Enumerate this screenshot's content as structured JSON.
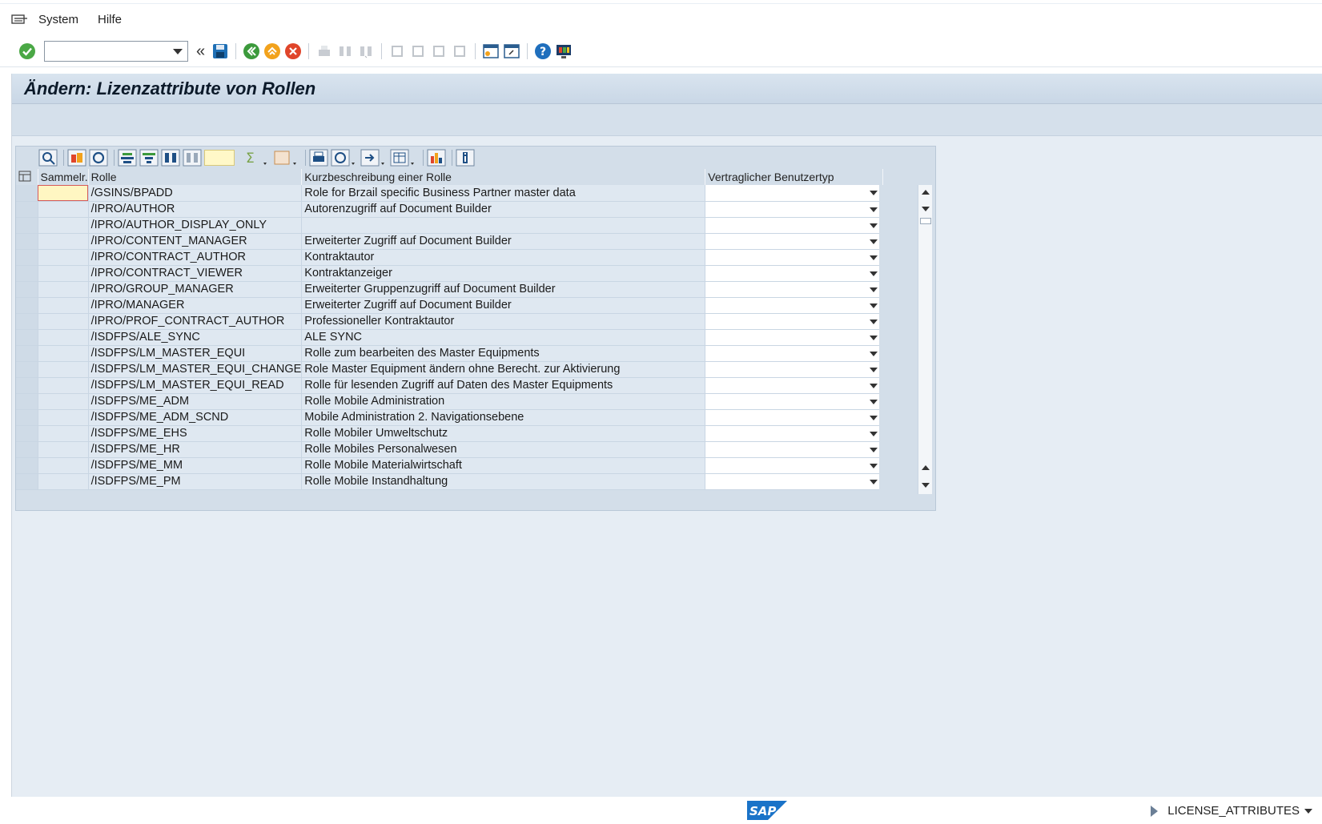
{
  "menu": {
    "items": [
      "System",
      "Hilfe"
    ]
  },
  "toolbar": {
    "command_value": "",
    "back_glyph": "«"
  },
  "screen": {
    "title": "Ändern: Lizenzattribute von Rollen"
  },
  "grid": {
    "columns": [
      "Sammelr.",
      "Rolle",
      "Kurzbeschreibung einer Rolle",
      "Vertraglicher Benutzertyp"
    ],
    "rows": [
      {
        "sammelr": "",
        "rolle": "/GSINS/BPADD",
        "beschreibung": "Role for Brzail specific Business Partner master data",
        "typ": ""
      },
      {
        "sammelr": "",
        "rolle": "/IPRO/AUTHOR",
        "beschreibung": "Autorenzugriff auf Document Builder",
        "typ": ""
      },
      {
        "sammelr": "",
        "rolle": "/IPRO/AUTHOR_DISPLAY_ONLY",
        "beschreibung": "",
        "typ": ""
      },
      {
        "sammelr": "",
        "rolle": "/IPRO/CONTENT_MANAGER",
        "beschreibung": "Erweiterter Zugriff auf Document Builder",
        "typ": ""
      },
      {
        "sammelr": "",
        "rolle": "/IPRO/CONTRACT_AUTHOR",
        "beschreibung": "Kontraktautor",
        "typ": ""
      },
      {
        "sammelr": "",
        "rolle": "/IPRO/CONTRACT_VIEWER",
        "beschreibung": "Kontraktanzeiger",
        "typ": ""
      },
      {
        "sammelr": "",
        "rolle": "/IPRO/GROUP_MANAGER",
        "beschreibung": "Erweiterter Gruppenzugriff auf Document Builder",
        "typ": ""
      },
      {
        "sammelr": "",
        "rolle": "/IPRO/MANAGER",
        "beschreibung": "Erweiterter Zugriff auf Document Builder",
        "typ": ""
      },
      {
        "sammelr": "",
        "rolle": "/IPRO/PROF_CONTRACT_AUTHOR",
        "beschreibung": "Professioneller Kontraktautor",
        "typ": ""
      },
      {
        "sammelr": "",
        "rolle": "/ISDFPS/ALE_SYNC",
        "beschreibung": "ALE SYNC",
        "typ": ""
      },
      {
        "sammelr": "",
        "rolle": "/ISDFPS/LM_MASTER_EQUI",
        "beschreibung": "Rolle zum bearbeiten des Master Equipments",
        "typ": ""
      },
      {
        "sammelr": "",
        "rolle": "/ISDFPS/LM_MASTER_EQUI_CHANGE",
        "beschreibung": "Role Master Equipment ändern ohne Berecht. zur Aktivierung",
        "typ": ""
      },
      {
        "sammelr": "",
        "rolle": "/ISDFPS/LM_MASTER_EQUI_READ",
        "beschreibung": "Rolle für lesenden Zugriff auf Daten des Master Equipments",
        "typ": ""
      },
      {
        "sammelr": "",
        "rolle": "/ISDFPS/ME_ADM",
        "beschreibung": "Rolle Mobile Administration",
        "typ": ""
      },
      {
        "sammelr": "",
        "rolle": "/ISDFPS/ME_ADM_SCND",
        "beschreibung": "Mobile Administration 2. Navigationsebene",
        "typ": ""
      },
      {
        "sammelr": "",
        "rolle": "/ISDFPS/ME_EHS",
        "beschreibung": "Rolle Mobiler Umweltschutz",
        "typ": ""
      },
      {
        "sammelr": "",
        "rolle": "/ISDFPS/ME_HR",
        "beschreibung": "Rolle Mobiles Personalwesen",
        "typ": ""
      },
      {
        "sammelr": "",
        "rolle": "/ISDFPS/ME_MM",
        "beschreibung": "Rolle Mobile Materialwirtschaft",
        "typ": ""
      },
      {
        "sammelr": "",
        "rolle": "/ISDFPS/ME_PM",
        "beschreibung": "Rolle Mobile Instandhaltung",
        "typ": ""
      }
    ]
  },
  "status": {
    "transaction": "LICENSE_ATTRIBUTES",
    "logo_text": "SAP"
  },
  "colors": {
    "accent_green": "#3aa33a",
    "accent_orange": "#f2a21c",
    "accent_red": "#e0452a",
    "sap_blue": "#1a73c8"
  }
}
